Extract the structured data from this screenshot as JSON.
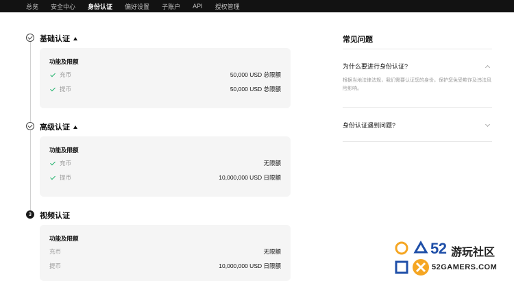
{
  "nav": {
    "items": [
      "总览",
      "安全中心",
      "身份认证",
      "偏好设置",
      "子账户",
      "API",
      "授权管理"
    ],
    "active_index": 2
  },
  "verification": {
    "levels": [
      {
        "title": "基础认证",
        "status": "completed",
        "card_heading": "功能及限额",
        "rows": [
          {
            "label": "充币",
            "value": "50,000 USD 总限额"
          },
          {
            "label": "提币",
            "value": "50,000 USD 总限额"
          }
        ]
      },
      {
        "title": "高级认证",
        "status": "completed",
        "card_heading": "功能及限额",
        "rows": [
          {
            "label": "充币",
            "value": "无限额"
          },
          {
            "label": "提币",
            "value": "10,000,000 USD 日限额"
          }
        ]
      },
      {
        "title": "视频认证",
        "status": "pending",
        "step_number": "3",
        "card_heading": "功能及限额",
        "rows": [
          {
            "label": "充币",
            "value": "无限额"
          },
          {
            "label": "提币",
            "value": "10,000,000 USD 日限额"
          }
        ]
      }
    ]
  },
  "faq": {
    "title": "常见问题",
    "items": [
      {
        "question": "为什么要进行身份认证?",
        "answer": "根据当地法律法规，我们需要认证您的身份，保护您免受欺诈及违法风险影响。",
        "expanded": true
      },
      {
        "question": "身份认证遇到问题?",
        "expanded": false
      }
    ]
  },
  "watermark": {
    "number": "52",
    "name": "游玩社区",
    "domain": "52GAMERS.COM"
  },
  "colors": {
    "nav_bg": "#121212",
    "accent_check": "#20b26c",
    "card_bg": "#f5f5f5",
    "watermark_blue": "#1f4fa8",
    "watermark_orange": "#f5a623"
  }
}
